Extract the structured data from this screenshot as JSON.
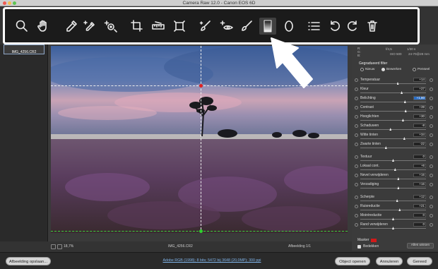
{
  "window": {
    "title": "Camera Raw 12.0 - Canon EOS 6D"
  },
  "toolbar": {
    "tools": [
      {
        "name": "zoom-tool"
      },
      {
        "name": "hand-tool"
      },
      {
        "name": "white-balance-tool"
      },
      {
        "name": "color-sampler-tool"
      },
      {
        "name": "targeted-adjustment-tool"
      },
      {
        "name": "crop-tool"
      },
      {
        "name": "straighten-tool"
      },
      {
        "name": "transform-tool"
      },
      {
        "name": "spot-removal-tool"
      },
      {
        "name": "red-eye-removal-tool"
      },
      {
        "name": "adjustment-brush-tool"
      },
      {
        "name": "graduated-filter-tool"
      },
      {
        "name": "radial-filter-tool"
      },
      {
        "name": "preferences-tool"
      },
      {
        "name": "rotate-left-tool"
      },
      {
        "name": "rotate-right-tool"
      },
      {
        "name": "delete-tool"
      }
    ]
  },
  "filmstrip": {
    "thumb_label": "IMG_4256.CR2"
  },
  "status": {
    "zoom": "18,7%",
    "filename": "IMG_4256.CR2",
    "image_count": "Afbeelding 1/1"
  },
  "panel": {
    "rgb_readout": {
      "r": "R:",
      "g": "G:",
      "b": "B:",
      "aperture": "f/4,5",
      "shutter": "1/30 s",
      "iso": "ISO 500",
      "lens": "24-70@28 mm"
    },
    "title": "Gegradueerd filter",
    "mode_options": [
      "Nieuw",
      "Bewerken",
      "Penseel"
    ],
    "mode_selected": "Bewerken",
    "sliders": [
      {
        "label": "Temperatuur",
        "value": "+14",
        "level": 0.57
      },
      {
        "label": "Kleur",
        "value": "+27",
        "level": 0.63
      },
      {
        "label": "Belichting",
        "value": "+1,80",
        "level": 0.68,
        "highlight": true
      },
      {
        "label": "Contrast",
        "value": "+39",
        "level": 0.69
      },
      {
        "label": "Hooglichten",
        "value": "+30",
        "level": 0.65
      },
      {
        "label": "Schaduwen",
        "value": "-8",
        "level": 0.46
      },
      {
        "label": "Witte tinten",
        "value": "+34",
        "level": 0.67
      },
      {
        "label": "Zwarte tinten",
        "value": "-22",
        "level": 0.39
      },
      {
        "label": "Textuur",
        "value": "0",
        "level": 0.5
      },
      {
        "label": "Lokaal cont.",
        "value": "+6",
        "level": 0.53
      },
      {
        "label": "Nevel verwijderen",
        "value": "+16",
        "level": 0.58
      },
      {
        "label": "Verzadiging",
        "value": "+16",
        "level": 0.58
      },
      {
        "label": "Scherpte",
        "value": "+12",
        "level": 0.56
      },
      {
        "label": "Ruisreductie",
        "value": "+21",
        "level": 0.6
      },
      {
        "label": "Moiréreductie",
        "value": "0",
        "level": 0.5
      },
      {
        "label": "Rand verwijderen",
        "value": "0",
        "level": 0.5
      }
    ],
    "mask_label": "Masker",
    "mask_color": "#d21a1a",
    "overlay_label": "Bedekken",
    "clear_all": "Alles wissen"
  },
  "bottom": {
    "save_image": "Afbeelding opslaan...",
    "workflow": "Adobe RGB (1998); 8 bits; 5472 bij 3648 (20,0MP); 300 ppi",
    "open_object": "Object openen",
    "cancel": "Annuleren",
    "done": "Gereed"
  }
}
